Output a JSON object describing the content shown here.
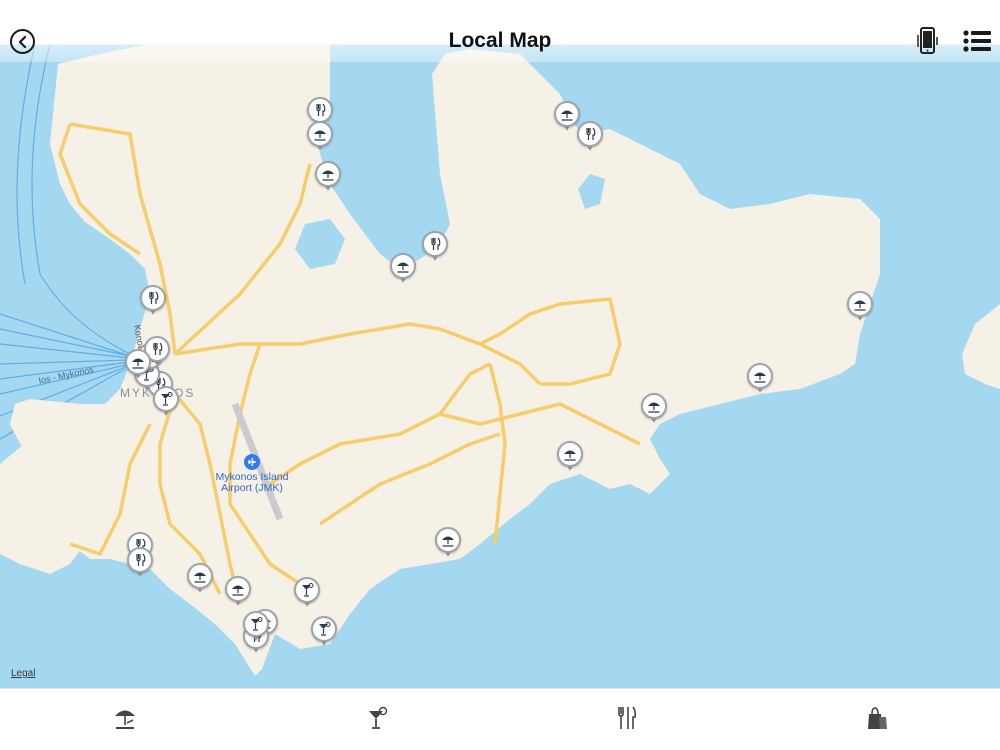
{
  "header": {
    "title": "Local Map",
    "back_icon": "chevron-left-circle-icon",
    "device_icon": "phone-icon",
    "menu_icon": "list-icon"
  },
  "map": {
    "town_label": "MYKONOS",
    "route_label": "Ios - Mykonos",
    "street_label": "Konou-Tourlou",
    "airport_label_line1": "Mykonos Island",
    "airport_label_line2": "Airport (JMK)",
    "legal": "Legal",
    "colors": {
      "water": "#a3d8f0",
      "land": "#f6f1e6",
      "road": "#f6cd6a",
      "pin_border": "#9da3a8",
      "icon": "#2b3b4a",
      "airport": "#3478f6"
    },
    "pins": [
      {
        "type": "restaurant"
      },
      {
        "type": "beach"
      },
      {
        "type": "beach"
      },
      {
        "type": "beach"
      },
      {
        "type": "restaurant"
      },
      {
        "type": "restaurant"
      },
      {
        "type": "beach"
      },
      {
        "type": "restaurant"
      },
      {
        "type": "beach"
      },
      {
        "type": "beach"
      },
      {
        "type": "beach"
      },
      {
        "type": "beach"
      },
      {
        "type": "beach"
      },
      {
        "type": "restaurant"
      },
      {
        "type": "restaurant"
      },
      {
        "type": "beach"
      },
      {
        "type": "beach"
      },
      {
        "type": "bar"
      },
      {
        "type": "beach"
      },
      {
        "type": "bar"
      },
      {
        "type": "restaurant"
      },
      {
        "type": "bar"
      },
      {
        "type": "restaurant"
      },
      {
        "type": "bar"
      },
      {
        "type": "bar"
      },
      {
        "type": "restaurant"
      },
      {
        "type": "restaurant"
      },
      {
        "type": "beach"
      }
    ]
  },
  "tabbar": {
    "tabs": [
      {
        "icon": "beach-umbrella-icon"
      },
      {
        "icon": "cocktail-icon"
      },
      {
        "icon": "fork-knife-icon"
      },
      {
        "icon": "shopping-bags-icon"
      }
    ]
  }
}
